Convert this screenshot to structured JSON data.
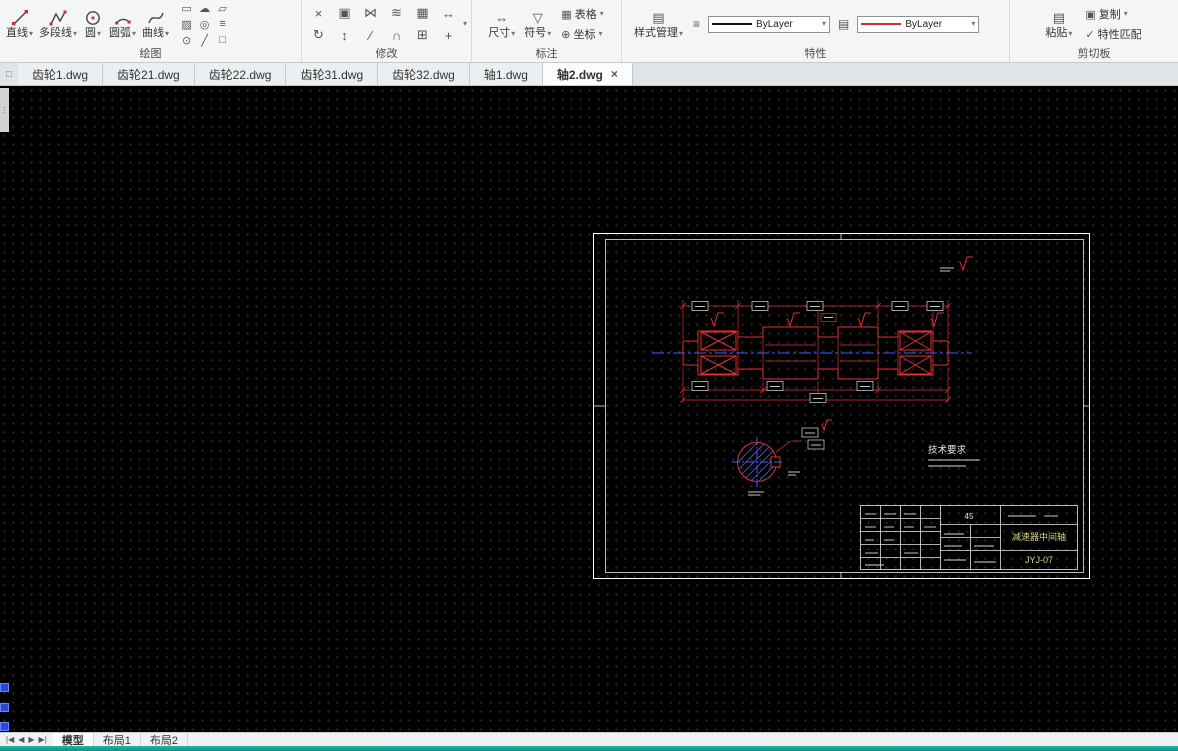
{
  "ribbon": {
    "panels": {
      "draw": {
        "label": "绘图",
        "tools": [
          {
            "label": "直线"
          },
          {
            "label": "多段线"
          },
          {
            "label": "圆"
          },
          {
            "label": "圆弧"
          },
          {
            "label": "曲线"
          }
        ]
      },
      "modify": {
        "label": "修改"
      },
      "annotate": {
        "label": "标注",
        "big_tools": [
          {
            "label": "尺寸"
          },
          {
            "label": "符号"
          }
        ],
        "small_tools": [
          {
            "label": "表格"
          },
          {
            "label": "坐标"
          }
        ]
      },
      "properties": {
        "label": "特性",
        "style_manager": "样式管理",
        "linetype_value": "ByLayer",
        "color_value": "ByLayer"
      },
      "clipboard": {
        "label": "剪切板",
        "paste": "粘贴",
        "copy": "复制",
        "match_properties": "特性匹配"
      }
    }
  },
  "doc_tabs": [
    {
      "label": "齿轮1.dwg"
    },
    {
      "label": "齿轮21.dwg"
    },
    {
      "label": "齿轮22.dwg"
    },
    {
      "label": "齿轮31.dwg"
    },
    {
      "label": "齿轮32.dwg"
    },
    {
      "label": "轴1.dwg"
    },
    {
      "label": "轴2.dwg",
      "active": true,
      "close": "×"
    }
  ],
  "drawing": {
    "tech_requirements": "技术要求",
    "title_block": {
      "material": "45",
      "part_name": "减速器中间轴",
      "drawing_number": "JYJ-07"
    },
    "colors": {
      "outline": "#ffffff",
      "geometry": "#e03131",
      "centerline": "#3b5bff"
    }
  },
  "layout_bar": {
    "tabs": [
      {
        "label": "模型",
        "active": true
      },
      {
        "label": "布局1"
      },
      {
        "label": "布局2"
      }
    ]
  }
}
